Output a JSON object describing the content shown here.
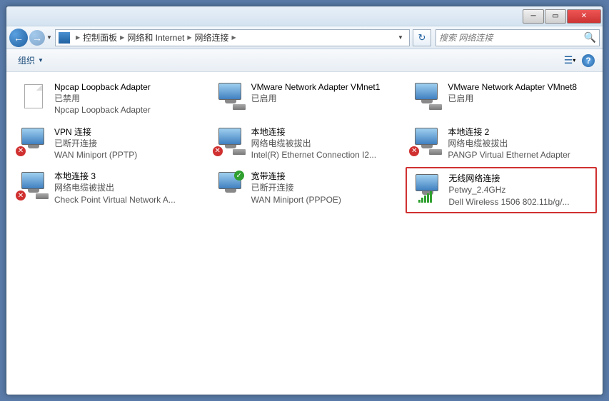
{
  "breadcrumb": {
    "item1": "控制面板",
    "item2": "网络和 Internet",
    "item3": "网络连接"
  },
  "search": {
    "placeholder": "搜索 网络连接"
  },
  "toolbar": {
    "organize": "组织"
  },
  "connections": [
    {
      "name": "Npcap Loopback Adapter",
      "status": "已禁用",
      "device": "Npcap Loopback Adapter",
      "icon": "file"
    },
    {
      "name": "VMware Network Adapter VMnet1",
      "status": "已启用",
      "device": "",
      "icon": "net-cable"
    },
    {
      "name": "VMware Network Adapter VMnet8",
      "status": "已启用",
      "device": "",
      "icon": "net-cable"
    },
    {
      "name": "VPN 连接",
      "status": "已断开连接",
      "device": "WAN Miniport (PPTP)",
      "icon": "net-x"
    },
    {
      "name": "本地连接",
      "status": "网络电缆被拔出",
      "device": "Intel(R) Ethernet Connection I2...",
      "icon": "net-x-cable"
    },
    {
      "name": "本地连接 2",
      "status": "网络电缆被拔出",
      "device": "PANGP Virtual Ethernet Adapter",
      "icon": "net-x-cable"
    },
    {
      "name": "本地连接 3",
      "status": "网络电缆被拔出",
      "device": "Check Point Virtual Network A...",
      "icon": "net-x-cable"
    },
    {
      "name": "宽带连接",
      "status": "已断开连接",
      "device": "WAN Miniport (PPPOE)",
      "icon": "net-check"
    },
    {
      "name": "无线网络连接",
      "status": "Petwy_2.4GHz",
      "device": "Dell Wireless 1506 802.11b/g/...",
      "icon": "net-signal",
      "highlight": true
    }
  ]
}
